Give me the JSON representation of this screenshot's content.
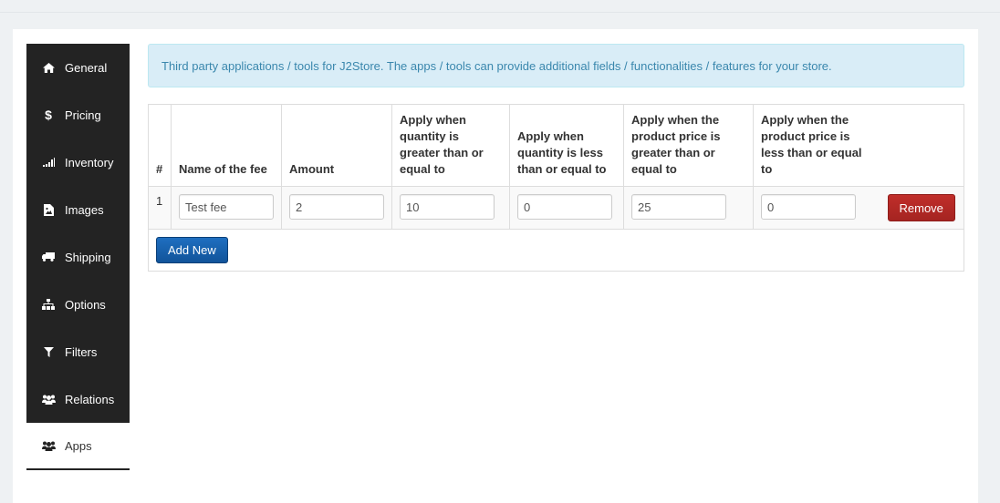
{
  "sidebar": {
    "items": [
      {
        "label": "General",
        "icon": "home-icon"
      },
      {
        "label": "Pricing",
        "icon": "dollar-icon"
      },
      {
        "label": "Inventory",
        "icon": "signal-icon"
      },
      {
        "label": "Images",
        "icon": "image-file-icon"
      },
      {
        "label": "Shipping",
        "icon": "truck-icon"
      },
      {
        "label": "Options",
        "icon": "sitemap-icon"
      },
      {
        "label": "Filters",
        "icon": "filter-icon"
      },
      {
        "label": "Relations",
        "icon": "users-icon"
      },
      {
        "label": "Apps",
        "icon": "users-icon"
      }
    ],
    "active": "Apps"
  },
  "alert": {
    "text": "Third party applications / tools for J2Store. The apps / tools can provide additional fields / functionalities / features for your store."
  },
  "table": {
    "headers": {
      "num": "#",
      "name": "Name of the fee",
      "amount": "Amount",
      "qty_min": "Apply when quantity is greater than or equal to",
      "qty_max": "Apply when quantity is less than or equal to",
      "price_min": "Apply when the product price is greater than or equal to",
      "price_max": "Apply when the product price is less than or equal to"
    },
    "rows": [
      {
        "num": "1",
        "name": "Test fee",
        "amount": "2",
        "qty_min": "10",
        "qty_max": "0",
        "price_min": "25",
        "price_max": "0",
        "remove_label": "Remove"
      }
    ],
    "add_label": "Add New"
  },
  "colors": {
    "sidebar_bg": "#232323",
    "alert_bg": "#d9edf7",
    "alert_text": "#3a87ad",
    "remove_btn": "#b02b27",
    "add_btn": "#1a62ad"
  }
}
